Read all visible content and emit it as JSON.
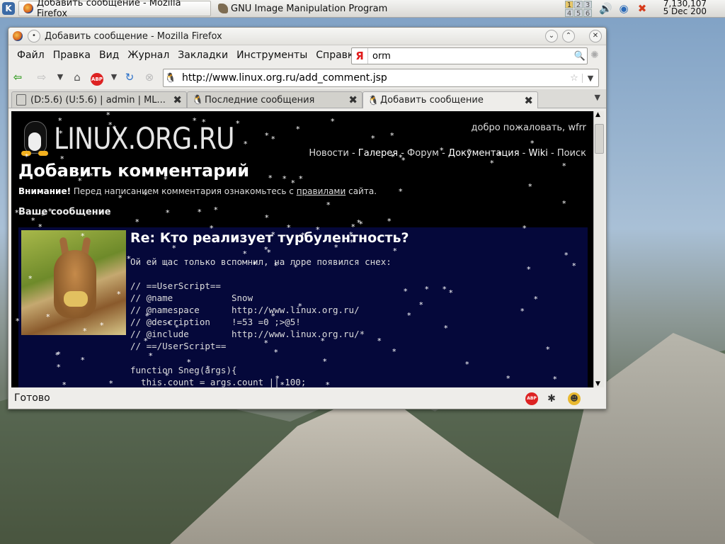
{
  "taskbar": {
    "kmenu_label": "K",
    "tasks": [
      {
        "label": "Добавить сообщение - Mozilla Firefox"
      },
      {
        "label": "GNU Image Manipulation Program"
      }
    ],
    "pager": [
      "1",
      "2",
      "3",
      "4",
      "5",
      "6"
    ],
    "clock": {
      "time": "7,130,107",
      "date": "5 Dec 200"
    }
  },
  "window": {
    "title": "Добавить сообщение - Mozilla Firefox",
    "menu": [
      "Файл",
      "Правка",
      "Вид",
      "Журнал",
      "Закладки",
      "Инструменты",
      "Справка"
    ],
    "search": {
      "engine_letter": "Я",
      "value": "orm"
    },
    "url": "http://www.linux.org.ru/add_comment.jsp",
    "tabs": [
      {
        "label": "(D:5.6) (U:5.6) | admin | ML..."
      },
      {
        "label": "Последние сообщения"
      },
      {
        "label": "Добавить сообщение"
      }
    ],
    "status": "Готово"
  },
  "page": {
    "logo_text": "LINUX.ORG.RU",
    "welcome": "добро пожаловать, wfrr",
    "nav": [
      "Новости",
      "Галерея",
      "Форум",
      "Документация",
      "Wiki",
      "Поиск"
    ],
    "heading": "Добавить комментарий",
    "notice": {
      "bold": "Внимание!",
      "before": " Перед написанием комментария ознакомьтесь с ",
      "link": "правилами",
      "after": " сайта."
    },
    "your_message": "Ваше сообщение",
    "message": {
      "title": "Re: Кто реализует турбулентность?",
      "intro": "Ой ей щас только вспомнил, на лоре появился снех:",
      "code": [
        "// ==UserScript==",
        "// @name           Snow",
        "// @namespace      http://www.linux.org.ru/",
        "// @description    !=53 =0 ;>@5!",
        "// @include        http://www.linux.org.ru/*",
        "// ==/UserScript==",
        "",
        "function Sneg(args){",
        "  this.count = args.count || 100;"
      ]
    }
  },
  "colors": {
    "page_bg": "#000000",
    "message_bg": "#05083a"
  }
}
